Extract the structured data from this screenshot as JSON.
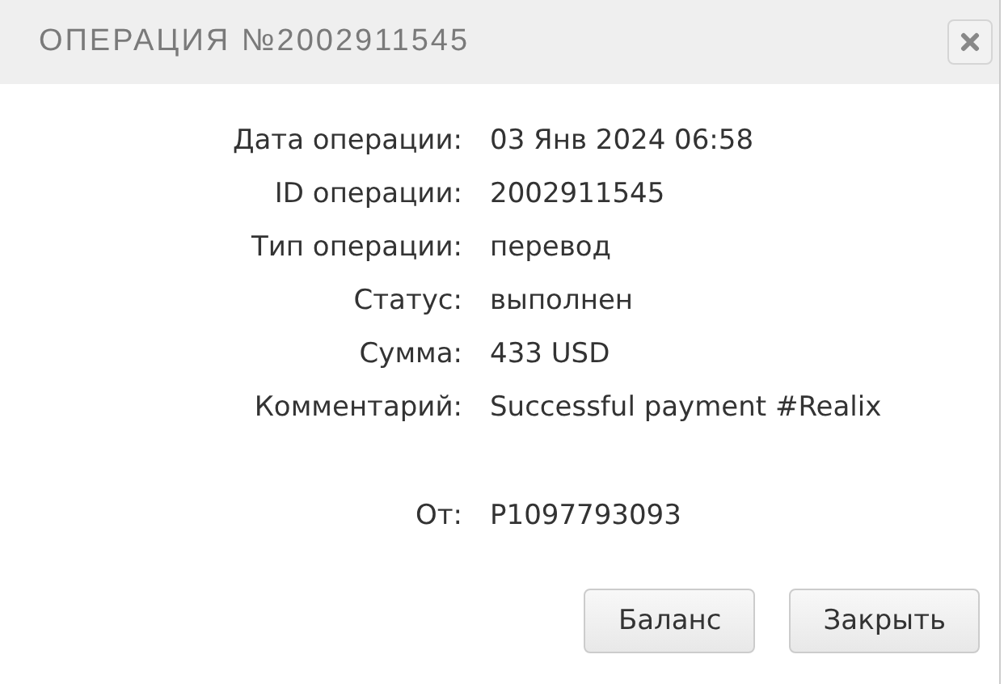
{
  "dialog": {
    "title": "ОПЕРАЦИЯ №2002911545"
  },
  "details": [
    {
      "label": "Дата операции:",
      "value": "03 Янв 2024 06:58"
    },
    {
      "label": "ID операции:",
      "value": "2002911545"
    },
    {
      "label": "Тип операции:",
      "value": "перевод"
    },
    {
      "label": "Статус:",
      "value": "выполнен"
    },
    {
      "label": "Сумма:",
      "value": "433 USD"
    },
    {
      "label": "Комментарий:",
      "value": "Successful payment #Realix"
    }
  ],
  "sender": {
    "label": "От:",
    "value": "P1097793093"
  },
  "buttons": [
    "Баланс",
    "Закрыть"
  ]
}
